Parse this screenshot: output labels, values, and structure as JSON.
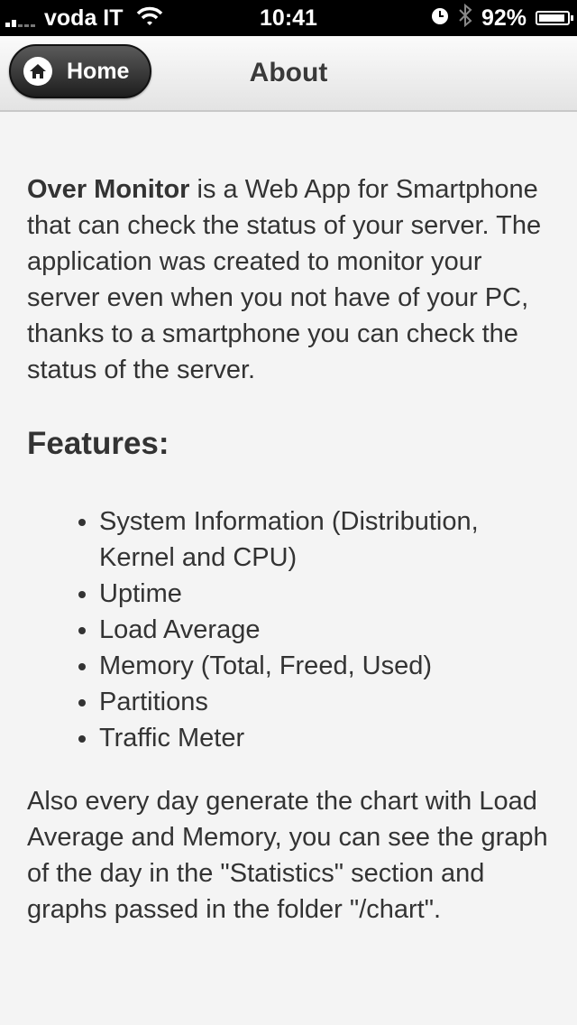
{
  "status_bar": {
    "carrier": "voda IT",
    "time": "10:41",
    "battery_percent": "92%",
    "battery_level": 0.92,
    "icons": [
      "signal-icon",
      "wifi-icon",
      "clock-icon",
      "bluetooth-icon",
      "battery-icon"
    ]
  },
  "header": {
    "home_label": "Home",
    "title": "About"
  },
  "content": {
    "app_name": "Over Monitor",
    "intro_rest": " is a Web App for Smartphone that can check the status of your server. The application was created to monitor your server even when you not have of your PC, thanks to a smartphone you can check the status of the server.",
    "features_heading": "Features:",
    "features": [
      "System Information (Distribution, Kernel and CPU)",
      "Uptime",
      "Load Average",
      "Memory (Total, Freed, Used)",
      "Partitions",
      "Traffic Meter"
    ],
    "outro": "Also every day generate the chart with Load Average and Memory, you can see the graph of the day in the \"Statistics\" section and graphs passed in the folder \"/chart\"."
  },
  "colors": {
    "status_bar_bg": "#000000",
    "header_gradient_top": "#fbfbfb",
    "header_gradient_bottom": "#e3e3e3",
    "home_button_bg": "#2a2a2a",
    "page_bg": "#f4f4f4",
    "text": "#333333"
  }
}
